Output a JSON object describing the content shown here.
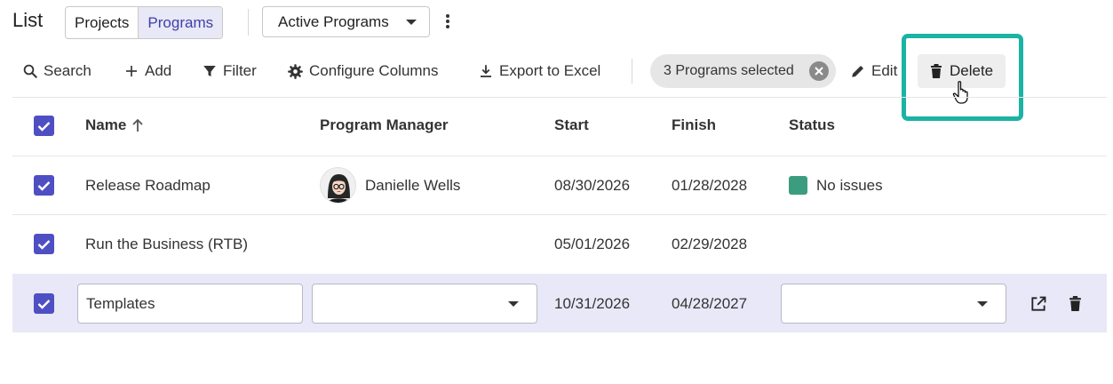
{
  "header": {
    "title": "List",
    "segments": [
      {
        "label": "Projects",
        "active": false
      },
      {
        "label": "Programs",
        "active": true
      }
    ],
    "view_select": "Active Programs"
  },
  "toolbar": {
    "search": "Search",
    "add": "Add",
    "filter": "Filter",
    "configure": "Configure Columns",
    "export": "Export to Excel",
    "selection_chip": "3 Programs selected",
    "edit": "Edit",
    "delete": "Delete"
  },
  "table": {
    "columns": [
      "Name",
      "Program Manager",
      "Start",
      "Finish",
      "Status"
    ],
    "rows": [
      {
        "name": "Release Roadmap",
        "manager": "Danielle Wells",
        "start": "08/30/2026",
        "finish": "01/28/2028",
        "status": "No issues",
        "checked": true
      },
      {
        "name": "Run the Business (RTB)",
        "manager": "",
        "start": "05/01/2026",
        "finish": "02/29/2028",
        "status": "",
        "checked": true
      },
      {
        "name": "Templates",
        "manager": "",
        "start": "10/31/2026",
        "finish": "04/28/2027",
        "status": "",
        "checked": true,
        "editing": true
      }
    ]
  },
  "colors": {
    "accent": "#4f4fc4",
    "highlight": "#1bb3a4",
    "status_ok": "#3c9c7e",
    "selected_row": "#e8e8f8"
  }
}
